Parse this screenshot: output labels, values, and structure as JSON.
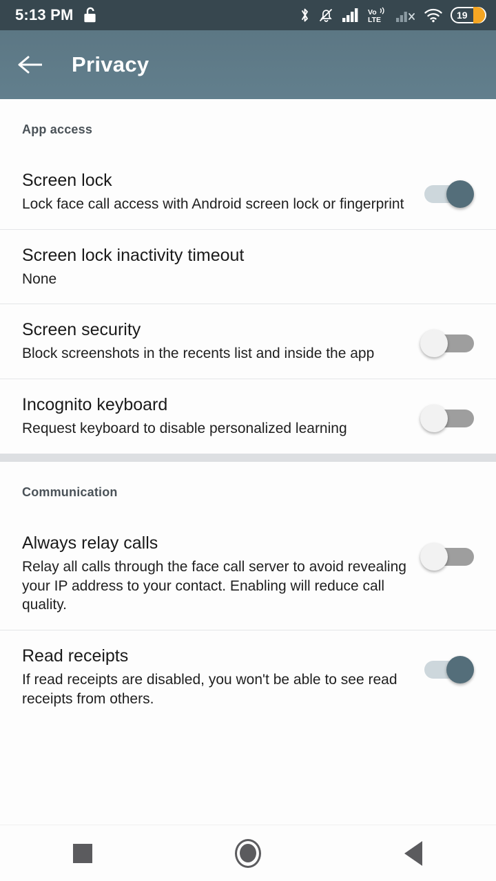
{
  "statusbar": {
    "time": "5:13 PM",
    "icons": [
      "unlock-icon",
      "bluetooth-icon",
      "notifications-muted-icon",
      "cellular-signal-icon",
      "volte-icon",
      "cellular-signal-no-service-icon",
      "wifi-icon"
    ],
    "volte_top": "Vo",
    "volte_bottom": "LTE",
    "battery_level": "19",
    "battery_color": "#f5a623"
  },
  "appbar": {
    "title": "Privacy",
    "back_label": "Back",
    "background_color": "#5f7c8a",
    "text_color": "#ffffff"
  },
  "sections": [
    {
      "header": "App access",
      "rows": [
        {
          "title": "Screen lock",
          "subtitle": "Lock face call access with Android screen lock or fingerprint",
          "control": "toggle",
          "state": "on"
        },
        {
          "title": "Screen lock inactivity timeout",
          "subtitle": "None",
          "control": "none",
          "state": ""
        },
        {
          "title": "Screen security",
          "subtitle": "Block screenshots in the recents list and inside the app",
          "control": "toggle",
          "state": "off"
        },
        {
          "title": "Incognito keyboard",
          "subtitle": "Request keyboard to disable personalized learning",
          "control": "toggle",
          "state": "off"
        }
      ]
    },
    {
      "header": "Communication",
      "rows": [
        {
          "title": "Always relay calls",
          "subtitle": "Relay all calls through the face call server to avoid revealing your IP address to your contact. Enabling will reduce call quality.",
          "control": "toggle",
          "state": "off"
        },
        {
          "title": "Read receipts",
          "subtitle": "If read receipts are disabled, you won't be able to see read receipts from others.",
          "control": "toggle",
          "state": "on"
        }
      ]
    }
  ],
  "navbar": {
    "recents_label": "Recents",
    "home_label": "Home",
    "back_label": "Back"
  },
  "colors": {
    "toggle_on_thumb": "#546e7a",
    "toggle_on_track": "#cdd7dc",
    "toggle_off_thumb": "#f2f2f2",
    "toggle_off_track": "#9e9e9e",
    "section_header_text": "#4a5258"
  }
}
